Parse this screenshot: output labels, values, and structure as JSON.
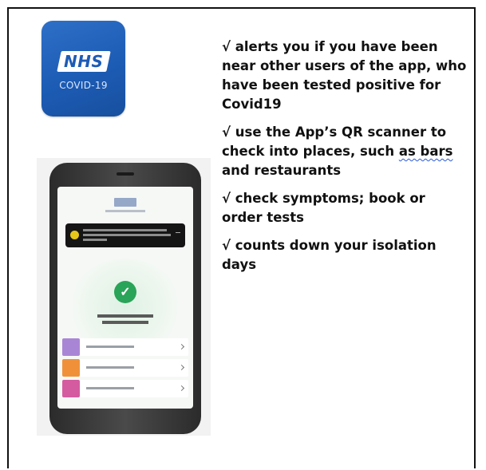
{
  "app_icon": {
    "logo": "NHS",
    "label": "COVID-19",
    "background": "#1d5cb5"
  },
  "bullets": [
    {
      "text_before": "√ alerts you if you have been near other users of the app, who have been tested positive for Covid19",
      "flagged": "",
      "text_after": ""
    },
    {
      "text_before": "√ use the App’s QR scanner to check into places, such ",
      "flagged": "as bars",
      "text_after": " and restaurants"
    },
    {
      "text_before": "√ check symptoms; book or order tests",
      "flagged": "",
      "text_after": ""
    },
    {
      "text_before": "√ counts down your isolation days",
      "flagged": "",
      "text_after": ""
    }
  ],
  "phone": {
    "check_icon": "✓",
    "check_color": "#2aa458",
    "banner_icon_color": "#e6c619",
    "menu_tiles": [
      "#a985d6",
      "#f0913a",
      "#d55ba0"
    ]
  }
}
